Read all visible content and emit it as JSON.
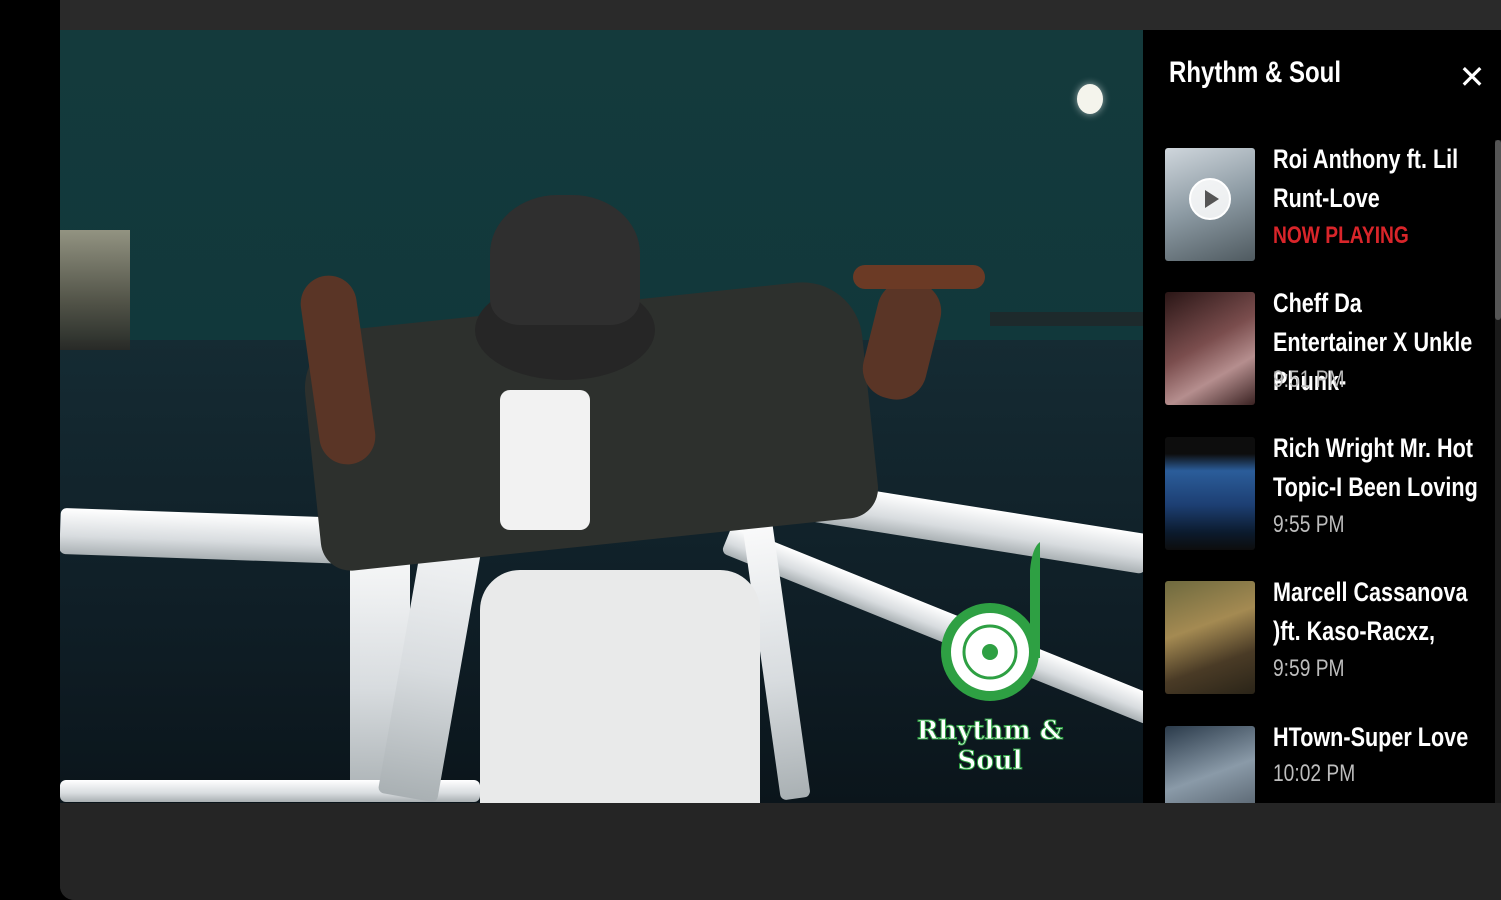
{
  "watermark": {
    "text": "Rhythm & Soul",
    "color": "#2ea043"
  },
  "sidebar": {
    "title": "Rhythm & Soul",
    "close_icon": "close-icon",
    "now_playing_color": "#d9252a",
    "items": [
      {
        "title": "Roi Anthony ft. Lil Runt-Love",
        "sub": "NOW PLAYING",
        "playing": true
      },
      {
        "title": "Cheff Da Entertainer X Unkle Phunk-",
        "sub": "9:51 PM",
        "playing": false
      },
      {
        "title": "Rich Wright Mr. Hot Topic-I Been Loving",
        "sub": "9:55 PM",
        "playing": false
      },
      {
        "title": "Marcell Cassanova )ft. Kaso-Racxz,",
        "sub": "9:59 PM",
        "playing": false
      },
      {
        "title": "HTown-Super Love",
        "sub": "10:02 PM",
        "playing": false
      }
    ]
  }
}
